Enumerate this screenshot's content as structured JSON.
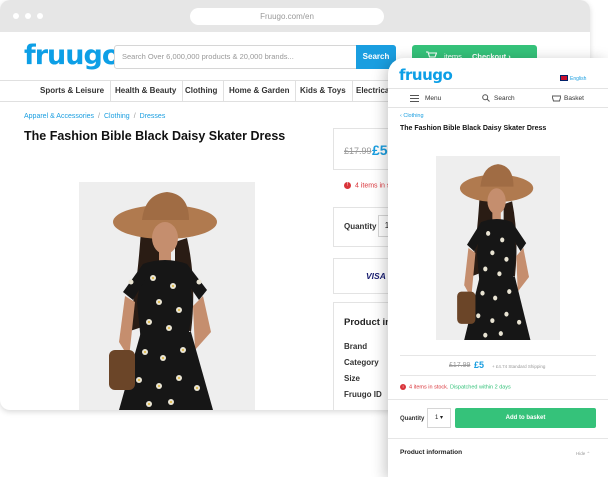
{
  "colors": {
    "brand": "#0d9fe6",
    "search_button": "#1a9ee0",
    "basket_green": "#35c27a",
    "stock_red": "#d9343a"
  },
  "browser": {
    "url": "Fruugo.com/en"
  },
  "header": {
    "logo": "fruugo",
    "search_placeholder": "Search Over 6,000,000 products & 20,000 brands...",
    "search_button": "Search",
    "basket_items": "items",
    "checkout": "Checkout ›"
  },
  "categories": [
    "Sports & Leisure",
    "Health & Beauty",
    "Clothing",
    "Home & Garden",
    "Kids & Toys",
    "Electricals"
  ],
  "breadcrumb": [
    "Apparel & Accessories",
    "Clothing",
    "Dresses"
  ],
  "product": {
    "title": "The Fashion Bible Black Daisy Skater Dress",
    "old_price": "£17.99",
    "new_price": "£5",
    "stock": "4 items in stock",
    "quantity_label": "Quantity",
    "quantity_value": "1",
    "payment": "VISA",
    "info_title": "Product info",
    "info_rows": [
      "Brand",
      "Category",
      "Size",
      "Fruugo ID"
    ]
  },
  "mobile": {
    "logo": "fruugo",
    "language": "English",
    "nav": {
      "menu": "Menu",
      "search": "Search",
      "basket": "Basket"
    },
    "back": "‹ Clothing",
    "title": "The Fashion Bible Black Daisy Skater Dress",
    "old_price": "£17.99",
    "new_price": "£5",
    "shipping": "+ £4.74 Standard Shipping",
    "stock": "4 items in stock.",
    "dispatch": "Dispatched within 2 days",
    "quantity_label": "Quantity",
    "quantity_value": "1 ▾",
    "add_to_basket": "Add to basket",
    "product_info": "Product information",
    "hide": "Hide ⌃"
  },
  "icons": [
    "basket-icon",
    "menu-icon",
    "search-icon",
    "uk-flag-icon",
    "mastercard-icon"
  ]
}
